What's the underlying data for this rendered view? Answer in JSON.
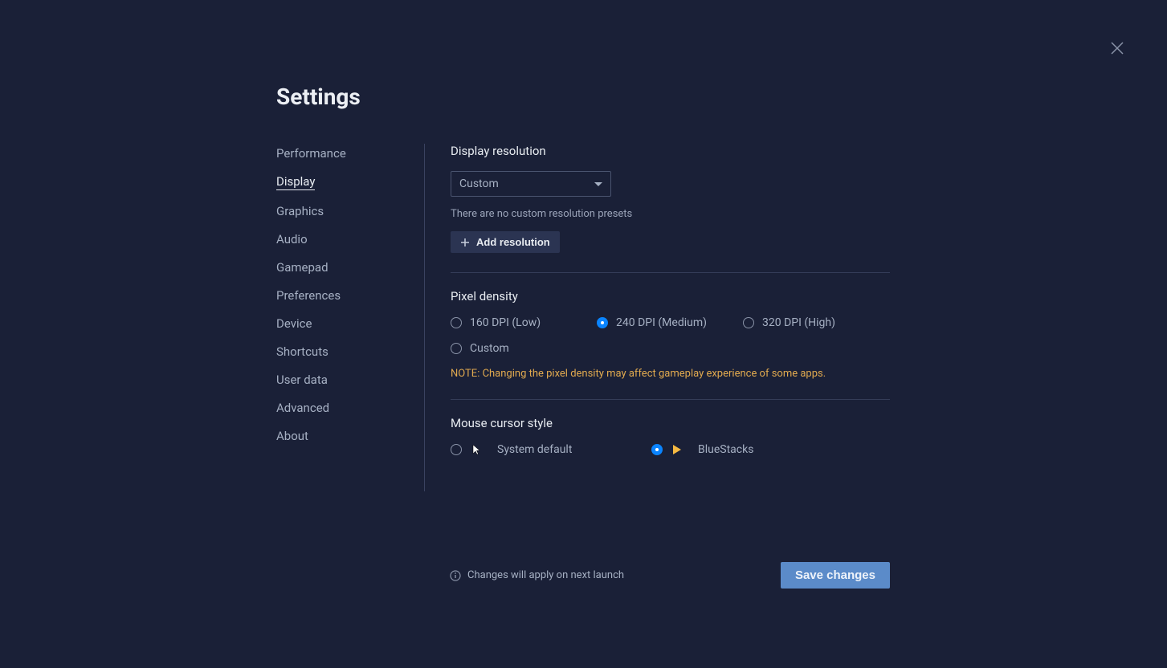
{
  "title": "Settings",
  "sidebar": {
    "items": [
      {
        "label": "Performance"
      },
      {
        "label": "Display"
      },
      {
        "label": "Graphics"
      },
      {
        "label": "Audio"
      },
      {
        "label": "Gamepad"
      },
      {
        "label": "Preferences"
      },
      {
        "label": "Device"
      },
      {
        "label": "Shortcuts"
      },
      {
        "label": "User data"
      },
      {
        "label": "Advanced"
      },
      {
        "label": "About"
      }
    ],
    "active_index": 1
  },
  "display_resolution": {
    "title": "Display resolution",
    "selected": "Custom",
    "helper": "There are no custom resolution presets",
    "add_button": "Add resolution"
  },
  "pixel_density": {
    "title": "Pixel density",
    "options": [
      {
        "label": "160 DPI (Low)",
        "selected": false
      },
      {
        "label": "240 DPI (Medium)",
        "selected": true
      },
      {
        "label": "320 DPI (High)",
        "selected": false
      },
      {
        "label": "Custom",
        "selected": false
      }
    ],
    "note": "NOTE: Changing the pixel density may affect gameplay experience of some apps."
  },
  "mouse_cursor": {
    "title": "Mouse cursor style",
    "options": [
      {
        "label": "System default",
        "selected": false
      },
      {
        "label": "BlueStacks",
        "selected": true
      }
    ]
  },
  "footer": {
    "note": "Changes will apply on next launch",
    "save": "Save changes"
  }
}
